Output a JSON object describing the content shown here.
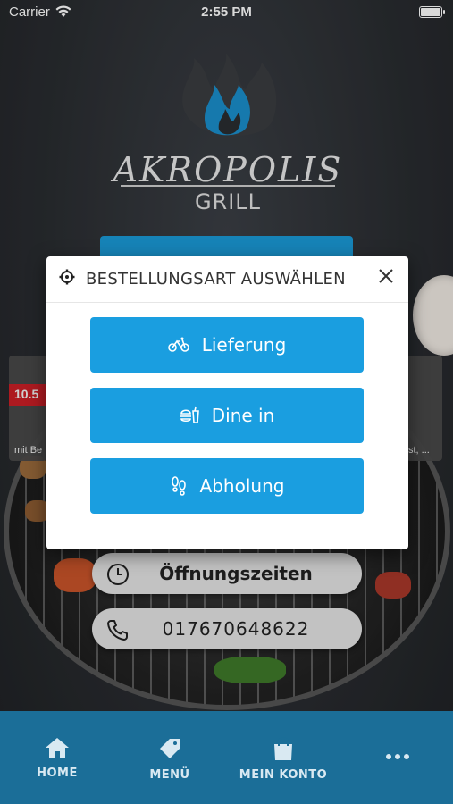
{
  "status_bar": {
    "carrier": "Carrier",
    "time": "2:55 PM"
  },
  "logo": {
    "name": "AKROPOLIS",
    "subtitle": "GRILL"
  },
  "promo": {
    "price": "10.5",
    "caption_left": "mit Be",
    "caption_right": "st, ..."
  },
  "modal": {
    "title": "BESTELLUNGSART AUSWÄHLEN",
    "options": [
      {
        "label": "Lieferung",
        "icon": "bicycle-icon"
      },
      {
        "label": "Dine in",
        "icon": "burger-icon"
      },
      {
        "label": "Abholung",
        "icon": "footsteps-icon"
      }
    ]
  },
  "info": {
    "hours_label": "Öffnungszeiten",
    "phone": "017670648622"
  },
  "tabs": [
    {
      "label": "HOME",
      "icon": "home-icon"
    },
    {
      "label": "MENÜ",
      "icon": "tag-icon"
    },
    {
      "label": "MEIN KONTO",
      "icon": "shopping-bag-icon"
    },
    {
      "label": "",
      "icon": "more-icon"
    }
  ],
  "colors": {
    "accent": "#1a9ee0",
    "tabbar": "#1b6e98"
  }
}
